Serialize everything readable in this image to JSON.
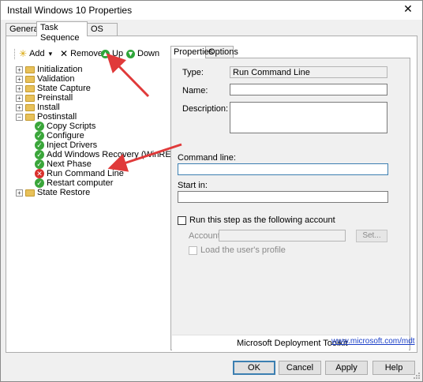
{
  "window": {
    "title": "Install Windows 10 Properties",
    "close_glyph": "✕"
  },
  "tabs": [
    {
      "label": "General"
    },
    {
      "label": "Task Sequence"
    },
    {
      "label": "OS Info"
    }
  ],
  "toolbar": {
    "add_label": "Add",
    "add_dropdown_glyph": "▾",
    "remove_label": "Remove",
    "up_label": "Up",
    "down_label": "Down"
  },
  "tree": [
    {
      "label": "Initialization",
      "icon": "folder-icon",
      "expander": "+"
    },
    {
      "label": "Validation",
      "icon": "folder-icon",
      "expander": "+"
    },
    {
      "label": "State Capture",
      "icon": "folder-icon",
      "expander": "+"
    },
    {
      "label": "Preinstall",
      "icon": "folder-icon",
      "expander": "+"
    },
    {
      "label": "Install",
      "icon": "folder-icon",
      "expander": "+"
    },
    {
      "label": "Postinstall",
      "icon": "folder-icon",
      "expander": "−"
    },
    {
      "label": "Copy Scripts",
      "icon": "check-icon"
    },
    {
      "label": "Configure",
      "icon": "check-icon"
    },
    {
      "label": "Inject Drivers",
      "icon": "check-icon"
    },
    {
      "label": "Add Windows Recovery (WinRE)",
      "icon": "check-icon"
    },
    {
      "label": "Next Phase",
      "icon": "check-icon"
    },
    {
      "label": "Run Command Line",
      "icon": "error-icon"
    },
    {
      "label": "Restart computer",
      "icon": "check-icon"
    },
    {
      "label": "State Restore",
      "icon": "folder-icon",
      "expander": "+"
    }
  ],
  "inner_tabs": [
    {
      "label": "Properties"
    },
    {
      "label": "Options"
    }
  ],
  "properties": {
    "type_label": "Type:",
    "type_value": "Run Command Line",
    "name_label": "Name:",
    "name_value": "",
    "description_label": "Description:",
    "description_value": "",
    "command_line_label": "Command line:",
    "command_line_value": "",
    "start_in_label": "Start in:",
    "start_in_value": "",
    "run_as_label": "Run this step as the following account",
    "account_label": "Account:",
    "account_value": "",
    "set_button": "Set...",
    "load_profile_label": "Load the user's profile"
  },
  "footer": {
    "brand": "Microsoft Deployment Toolkit",
    "link": "www.microsoft.com/mdt"
  },
  "buttons": {
    "ok": "OK",
    "cancel": "Cancel",
    "apply": "Apply",
    "help": "Help"
  },
  "colors": {
    "annotation_arrow": "#e03a3a",
    "success_icon": "#3aa63a",
    "error_icon": "#d9302c",
    "link": "#1a3ec7"
  }
}
